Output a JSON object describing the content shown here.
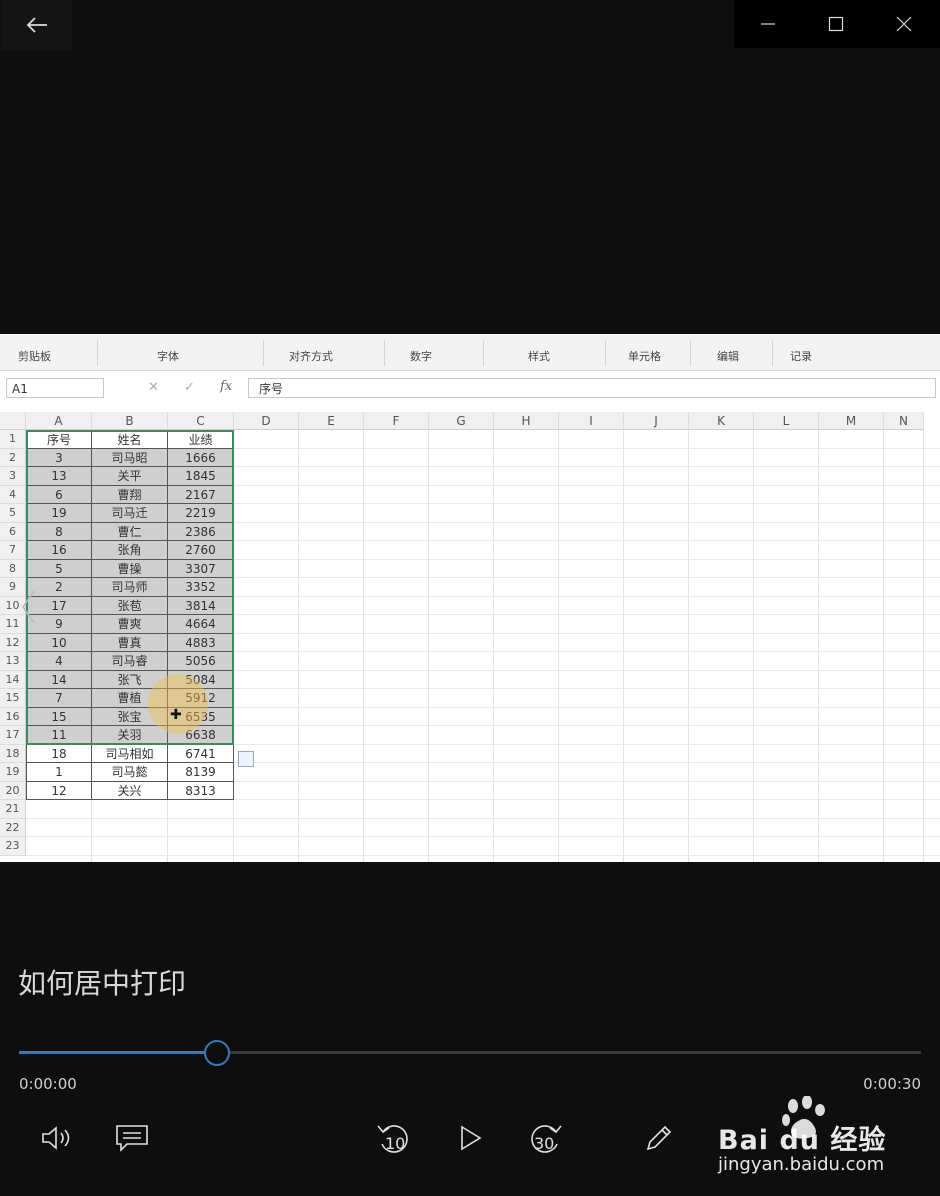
{
  "window": {
    "back_icon": "arrow-left-icon",
    "minimize_icon": "minimize-icon",
    "maximize_icon": "maximize-icon",
    "close_icon": "close-icon"
  },
  "excel": {
    "ribbon_groups": [
      "剪贴板",
      "字体",
      "对齐方式",
      "数字",
      "样式",
      "单元格",
      "编辑",
      "记录"
    ],
    "name_box": "A1",
    "formula_value": "序号",
    "fx_label": "fx",
    "columns": [
      "A",
      "B",
      "C",
      "D",
      "E",
      "F",
      "G",
      "H",
      "I",
      "J",
      "K",
      "L",
      "M",
      "N"
    ],
    "rows": [
      "1",
      "2",
      "3",
      "4",
      "5",
      "6",
      "7",
      "8",
      "9",
      "10",
      "11",
      "12",
      "13",
      "14",
      "15",
      "16",
      "17",
      "18",
      "19",
      "20",
      "21",
      "22",
      "23"
    ],
    "table_header": [
      "序号",
      "姓名",
      "业绩"
    ],
    "table_rows": [
      [
        "3",
        "司马昭",
        "1666"
      ],
      [
        "13",
        "关平",
        "1845"
      ],
      [
        "6",
        "曹翔",
        "2167"
      ],
      [
        "19",
        "司马迁",
        "2219"
      ],
      [
        "8",
        "曹仁",
        "2386"
      ],
      [
        "16",
        "张角",
        "2760"
      ],
      [
        "5",
        "曹操",
        "3307"
      ],
      [
        "2",
        "司马师",
        "3352"
      ],
      [
        "17",
        "张苞",
        "3814"
      ],
      [
        "9",
        "曹爽",
        "4664"
      ],
      [
        "10",
        "曹真",
        "4883"
      ],
      [
        "4",
        "司马睿",
        "5056"
      ],
      [
        "14",
        "张飞",
        "5084"
      ],
      [
        "7",
        "曹植",
        "5912"
      ],
      [
        "15",
        "张宝",
        "6535"
      ],
      [
        "11",
        "关羽",
        "6638"
      ],
      [
        "18",
        "司马相如",
        "6741"
      ],
      [
        "1",
        "司马懿",
        "8139"
      ],
      [
        "12",
        "关兴",
        "8313"
      ]
    ],
    "selected_rows": 17
  },
  "player": {
    "title": "如何居中打印",
    "current_time": "0:00:00",
    "total_time": "0:00:30",
    "progress": 0.22,
    "accent": "#3c78b4",
    "skip_back_label": "10",
    "skip_forward_label": "30",
    "volume_icon": "volume-icon",
    "captions_icon": "captions-icon",
    "play_icon": "play-icon",
    "edit_icon": "pencil-icon"
  },
  "watermark": {
    "brand": "Bai du 经验",
    "url": "jingyan.baidu.com"
  }
}
